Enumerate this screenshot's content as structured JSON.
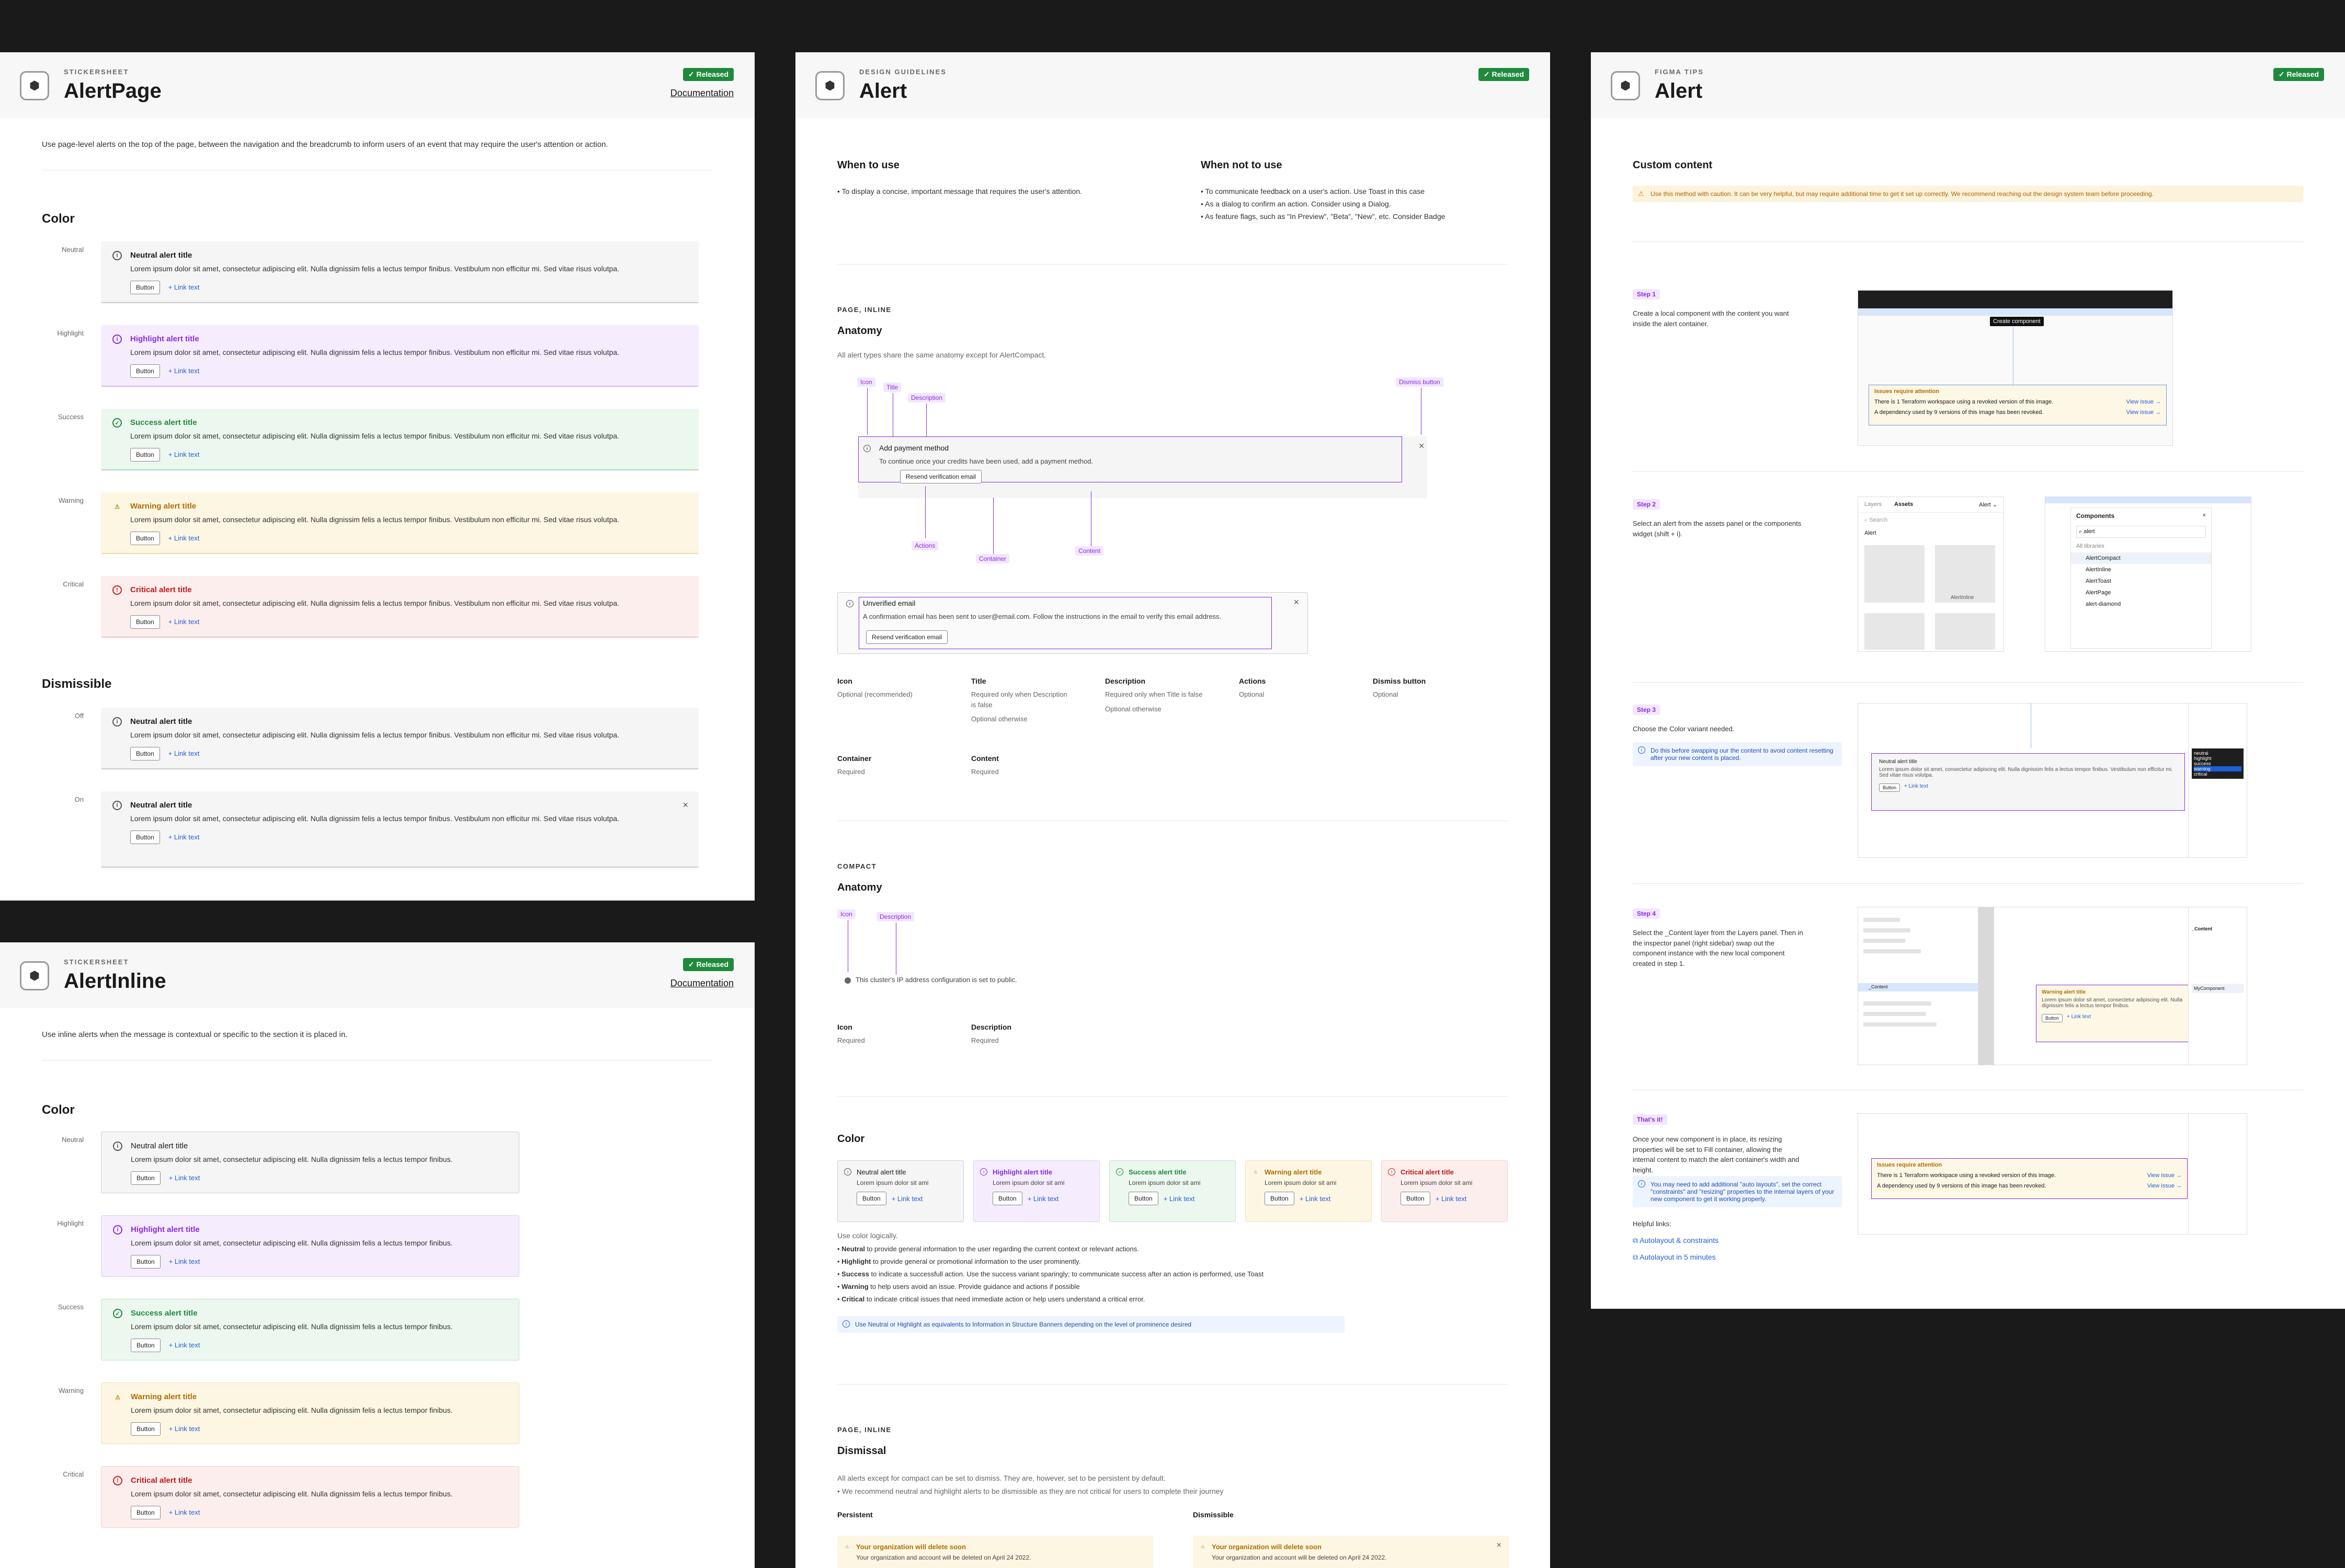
{
  "badge_text": "✓ Released",
  "doc_link": "Documentation",
  "common": {
    "lorem_long": "Lorem ipsum dolor sit amet, consectetur adipiscing elit. Nulla dignissim felis a lectus tempor finibus. Vestibulum non efficitur mi. Sed vitae risus volutpa.",
    "lorem_short": "Lorem ipsum dolor sit amet, consectetur adipiscing elit. Nulla dignissim felis a lectus tempor finibus.",
    "lorem_tiny": "Lorem ipsum dolor sit ami",
    "button": "Button",
    "link": "+ Link text",
    "titles": {
      "neutral": "Neutral alert title",
      "highlight": "Highlight alert title",
      "success": "Success alert title",
      "warning": "Warning alert title",
      "critical": "Critical alert title"
    },
    "labels": {
      "neutral": "Neutral",
      "highlight": "Highlight",
      "success": "Success",
      "warning": "Warning",
      "critical": "Critical",
      "off": "Off",
      "on": "On"
    }
  },
  "alertpage": {
    "kicker": "STICKERSHEET",
    "title": "AlertPage",
    "intro": "Use page-level alerts on the top of the page, between the navigation and the breadcrumb to inform users of an event that may require the user's attention or action.",
    "color_heading": "Color",
    "dismissible_heading": "Dismissible"
  },
  "alertinline": {
    "kicker": "STICKERSHEET",
    "title": "AlertInline",
    "intro": "Use inline alerts when the message is contextual or specific to the section it is placed in.",
    "color_heading": "Color"
  },
  "guidelines": {
    "kicker": "DESIGN GUIDELINES",
    "title": "Alert",
    "when_to_use": "When to use",
    "when_to_use_items": [
      "To display a concise, important message that requires the user's attention."
    ],
    "when_not_to_use": "When not to use",
    "when_not_items": [
      "To communicate feedback on a user's action. Use Toast in this case",
      "As a dialog to confirm an action. Consider using a Dialog.",
      "As feature flags, such as \"In Preview\", \"Beta\", \"New\", etc. Consider Badge"
    ],
    "anatomy_cap": "PAGE, INLINE",
    "anatomy_heading": "Anatomy",
    "anatomy_intro": "All alert types share the same anatomy except for AlertCompact.",
    "annot": {
      "icon": "Icon",
      "title": "Title",
      "description": "Description",
      "dismiss": "Dismiss button",
      "actions": "Actions",
      "container": "Container",
      "content": "Content"
    },
    "demo1": {
      "title": "Add payment method",
      "body": "To continue once your credits have been used, add a payment method.",
      "button": "Resend verification email"
    },
    "demo2": {
      "title": "Unverified email",
      "body": "A confirmation email has been sent to user@email.com. Follow the instructions in the email to verify this email address.",
      "button": "Resend verification email"
    },
    "parts": [
      {
        "name": "Icon",
        "desc": "Optional (recommended)"
      },
      {
        "name": "Title",
        "desc": "Required only when Description is false",
        "desc2": "Optional otherwise"
      },
      {
        "name": "Description",
        "desc": "Required only when Title is false",
        "desc2": "Optional otherwise"
      },
      {
        "name": "Actions",
        "desc": "Optional"
      },
      {
        "name": "Dismiss button",
        "desc": "Optional"
      }
    ],
    "parts2": [
      {
        "name": "Container",
        "desc": "Required"
      },
      {
        "name": "Content",
        "desc": "Required"
      }
    ],
    "compact_cap": "COMPACT",
    "compact_heading": "Anatomy",
    "compact_annot": {
      "icon": "Icon",
      "description": "Description"
    },
    "compact_text": "This cluster's IP address configuration is set to public.",
    "compact_parts": [
      {
        "name": "Icon",
        "desc": "Required"
      },
      {
        "name": "Description",
        "desc": "Required"
      }
    ],
    "color_heading": "Color",
    "color_intro": "Use color logically.",
    "color_items": [
      {
        "b": "Neutral",
        "t": " to provide general information to the user regarding the current context or relevant actions."
      },
      {
        "b": "Highlight",
        "t": " to provide general or promotional information to the user prominently."
      },
      {
        "b": "Success",
        "t": " to indicate a successfull action. Use the success variant sparingly; to communicate success after an action is performed, use Toast"
      },
      {
        "b": "Warning",
        "t": " to help users avoid an issue. Provide guidance and actions if possible"
      },
      {
        "b": "Critical",
        "t": " to indicate critical issues that need immediate action or help users understand a critical error."
      }
    ],
    "color_note": "Use Neutral or Highlight as equivalents to Information in Structure Banners depending on the level of prominence desired",
    "dismissal_cap": "PAGE, INLINE",
    "dismissal_heading": "Dismissal",
    "dismissal_intro": "All alerts except for compact can be set to dismiss. They are, however, set to be persistent by default.",
    "dismissal_bullet": "We recommend neutral and highlight alerts to be dismissible as they are not critical for users to complete their journey",
    "persistent": "Persistent",
    "dismissible": "Dismissible",
    "org_title": "Your organization will delete soon",
    "org_body": "Your organization and account will be deleted on April 24 2022."
  },
  "figma": {
    "kicker": "FIGMA TIPS",
    "title": "Alert",
    "custom_heading": "Custom content",
    "caution": "Use this method with caution. It can be very helpful, but may require additional time to get it set up correctly. We recommend reaching out the design system team before proceeding.",
    "steps": [
      {
        "label": "Step 1",
        "text": "Create a local component with the content you want inside the alert container."
      },
      {
        "label": "Step 2",
        "text": "Select an alert from the assets panel or the components widget (shift + i)."
      },
      {
        "label": "Step 3",
        "text": "Choose the Color variant needed."
      },
      {
        "label": "Step 4",
        "text": "Select the _Content layer from the Layers panel. Then in the inspector panel (right sidebar) swap out the component instance with the new local component created in step 1."
      },
      {
        "label": "That's it!",
        "text": "Once your new component is in place, its resizing properties will be set to Fill container, allowing the internal content to match the alert container's width and height."
      }
    ],
    "step3_note": "Do this before swapping our the content to avoid content resetting after your new content is placed.",
    "final_note": "You may need to add additional \"auto layouts\", set the correct \"constraints\" and \"resizing\" properties to the internal layers of your new component to get it working properly.",
    "helpful": "Helpful links:",
    "links": [
      "Autolayout & constraints",
      "Autolayout in 5 minutes"
    ],
    "tooltip": "Create component",
    "issues_title": "Issues require attention",
    "issue1": "There is 1 Terraform workspace using a revoked version of this image.",
    "issue2": "A dependency used by 9 versions of this image has been revoked.",
    "view_issue": "View issue →",
    "panel_tabs": [
      "Layers",
      "Assets",
      "Alert ⌄"
    ],
    "search": "Search",
    "alert_label": "Alert",
    "alertinline_label": "AlertInline",
    "components_title": "Components",
    "components_search": "alert",
    "all_libraries": "All libraries",
    "components_list": [
      "AlertCompact",
      "AlertInline",
      "AlertToast",
      "AlertPage",
      "alert-diamond"
    ],
    "variants": [
      "neutral",
      "highlight",
      "success",
      "warning",
      "critical"
    ],
    "content_label": "_Content",
    "mycomponent": "MyComponent"
  }
}
